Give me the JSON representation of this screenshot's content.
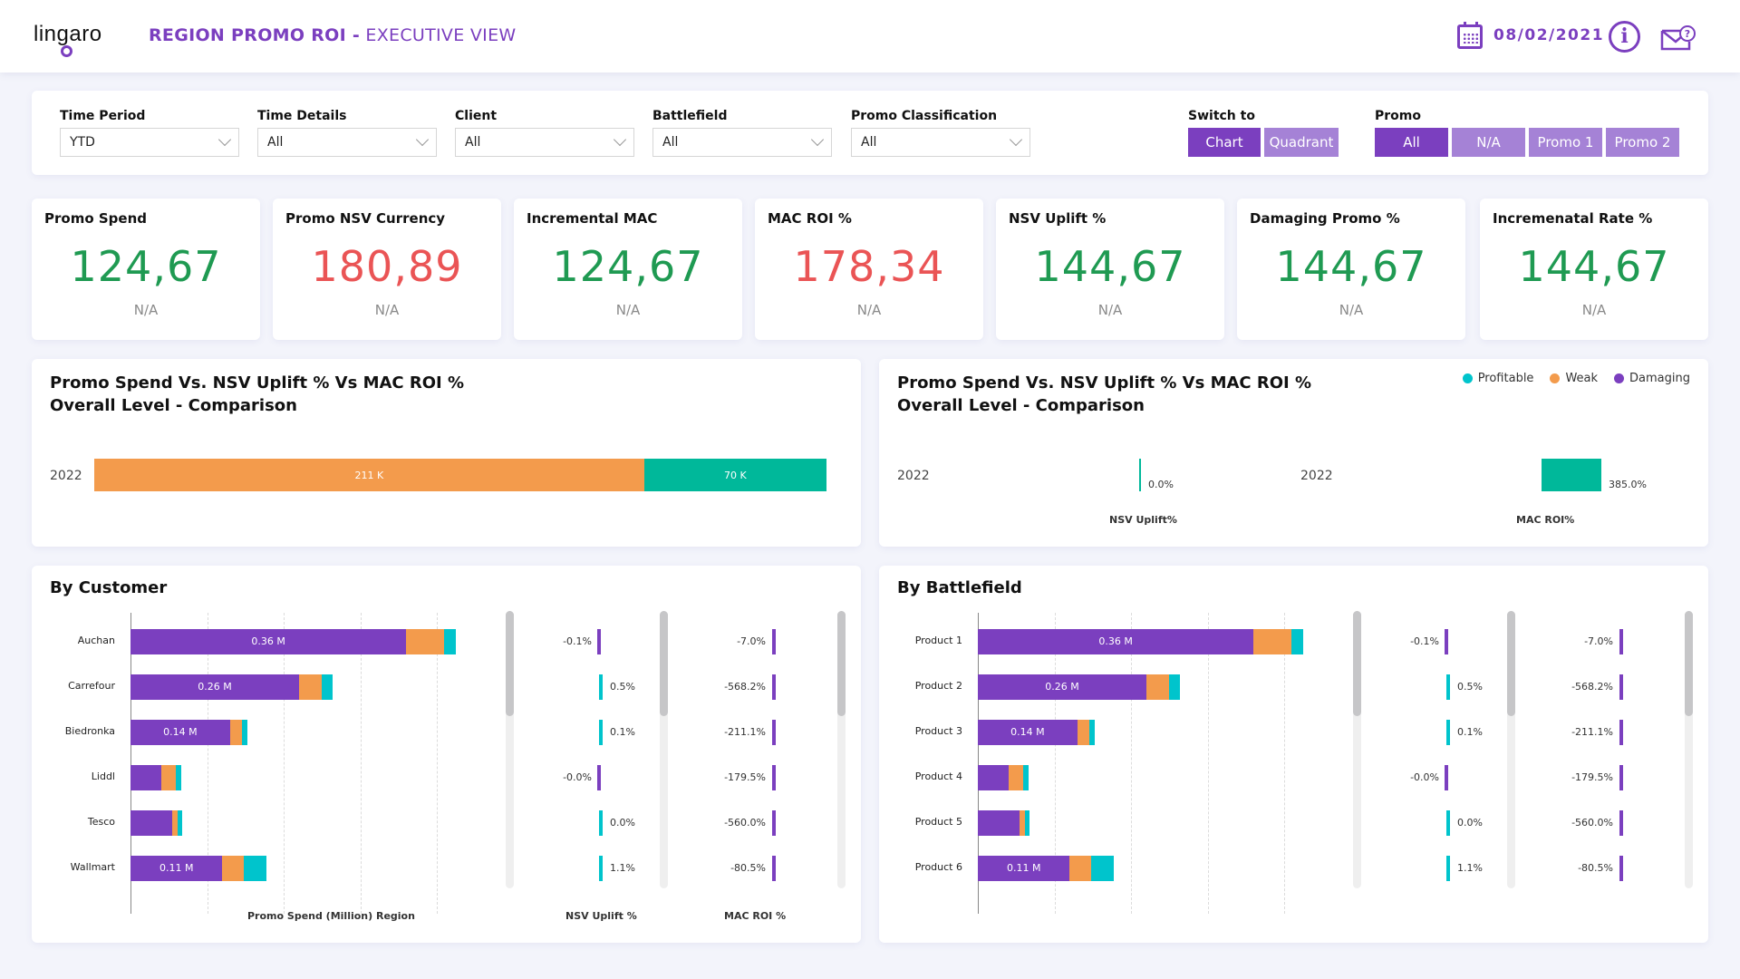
{
  "header": {
    "logo": "lingaro",
    "title_bold": "REGION PROMO ROI -",
    "title_light": " EXECUTIVE VIEW",
    "date": "08/02/2021",
    "icons": [
      "calendar-icon",
      "info-icon",
      "mail-help-icon"
    ]
  },
  "filters": {
    "dropdowns": [
      {
        "label": "Time Period",
        "value": "YTD"
      },
      {
        "label": "Time Details",
        "value": "All"
      },
      {
        "label": "Client",
        "value": "All"
      },
      {
        "label": "Battlefield",
        "value": "All"
      },
      {
        "label": "Promo Classification",
        "value": "All"
      }
    ],
    "switch_to": {
      "label": "Switch to",
      "options": [
        "Chart",
        "Quadrant"
      ],
      "selected": "Chart"
    },
    "promo": {
      "label": "Promo",
      "options": [
        "All",
        "N/A",
        "Promo 1",
        "Promo 2"
      ],
      "selected": "All"
    }
  },
  "colors": {
    "accent": "#7b3fbf",
    "accent_light": "#a582d6",
    "positive": "#1f9a52",
    "negative": "#ea5455",
    "profitable": "#00c4cc",
    "weak": "#f39b4c",
    "damaging": "#7b3fbf",
    "overall_teal": "#00b89a"
  },
  "kpis": [
    {
      "title": "Promo Spend",
      "value": "124,67",
      "sub": "N/A",
      "tone": "green"
    },
    {
      "title": "Promo NSV Currency",
      "value": "180,89",
      "sub": "N/A",
      "tone": "red"
    },
    {
      "title": "Incremental MAC",
      "value": "124,67",
      "sub": "N/A",
      "tone": "green"
    },
    {
      "title": "MAC ROI %",
      "value": "178,34",
      "sub": "N/A",
      "tone": "red"
    },
    {
      "title": "NSV Uplift %",
      "value": "144,67",
      "sub": "N/A",
      "tone": "green"
    },
    {
      "title": "Damaging Promo %",
      "value": "144,67",
      "sub": "N/A",
      "tone": "green"
    },
    {
      "title": "Incremenatal Rate %",
      "value": "144,67",
      "sub": "N/A",
      "tone": "green"
    }
  ],
  "legend": [
    {
      "label": "Profitable",
      "color": "#00c4cc"
    },
    {
      "label": "Weak",
      "color": "#f39b4c"
    },
    {
      "label": "Damaging",
      "color": "#7b3fbf"
    }
  ],
  "chart_data": [
    {
      "type": "bar",
      "orientation": "horizontal-stacked",
      "title": "Promo Spend Vs. NSV Uplift % Vs MAC ROI %",
      "subtitle": "Overall Level - Comparison",
      "categories": [
        "2022"
      ],
      "series": [
        {
          "name": "Weak",
          "values": [
            211
          ],
          "label": "211 K",
          "color": "#f39b4c"
        },
        {
          "name": "Profitable",
          "values": [
            70
          ],
          "label": "70 K",
          "color": "#00b89a"
        }
      ],
      "unit": "K"
    },
    {
      "type": "bar",
      "orientation": "horizontal",
      "title": "Promo Spend Vs. NSV Uplift % Vs MAC ROI %",
      "subtitle": "Overall Level - Comparison",
      "legend_position": "top-right",
      "panels": [
        {
          "xlabel": "NSV Uplift%",
          "categories": [
            "2022"
          ],
          "values": [
            0.0
          ],
          "labels": [
            "0.0%"
          ]
        },
        {
          "xlabel": "MAC ROI%",
          "categories": [
            "2022"
          ],
          "values": [
            385.0
          ],
          "labels": [
            "385.0%"
          ]
        }
      ]
    },
    {
      "type": "bar",
      "orientation": "horizontal-stacked",
      "title": "By Customer",
      "xlabel": "Promo Spend (Million) Region",
      "xlim": [
        0,
        0.45
      ],
      "grid": true,
      "categories": [
        "Auchan",
        "Carrefour",
        "Biedronka",
        "Liddl",
        "Tesco",
        "Wallmart"
      ],
      "series": [
        {
          "name": "Damaging",
          "values": [
            0.36,
            0.22,
            0.13,
            0.04,
            0.055,
            0.12
          ]
        },
        {
          "name": "Weak",
          "values": [
            0.05,
            0.03,
            0.016,
            0.019,
            0.006,
            0.028
          ]
        },
        {
          "name": "Profitable",
          "values": [
            0.015,
            0.014,
            0.007,
            0.007,
            0.007,
            0.03
          ]
        }
      ],
      "bar_labels": [
        "0.36 M",
        "0.26 M",
        "0.14 M",
        "",
        "",
        "0.11 M"
      ],
      "nsv_uplift": {
        "xlabel": "NSV Uplift %",
        "values": [
          -0.1,
          0.5,
          0.1,
          -0.0,
          0.0,
          1.1
        ],
        "labels": [
          "-0.1%",
          "0.5%",
          "0.1%",
          "-0.0%",
          "0.0%",
          "1.1%"
        ]
      },
      "mac_roi": {
        "xlabel": "MAC ROI %",
        "values": [
          -7.0,
          -568.2,
          -211.1,
          -179.5,
          -560.0,
          -80.5
        ],
        "labels": [
          "-7.0%",
          "-568.2%",
          "-211.1%",
          "-179.5%",
          "-560.0%",
          "-80.5%"
        ]
      }
    },
    {
      "type": "bar",
      "orientation": "horizontal-stacked",
      "title": "By Battlefield",
      "xlim": [
        0,
        0.45
      ],
      "grid": true,
      "categories": [
        "Product 1",
        "Product 2",
        "Product 3",
        "Product 4",
        "Product 5",
        "Product 6"
      ],
      "series": [
        {
          "name": "Damaging",
          "values": [
            0.36,
            0.22,
            0.13,
            0.04,
            0.055,
            0.12
          ]
        },
        {
          "name": "Weak",
          "values": [
            0.05,
            0.03,
            0.016,
            0.019,
            0.006,
            0.028
          ]
        },
        {
          "name": "Profitable",
          "values": [
            0.015,
            0.014,
            0.007,
            0.007,
            0.007,
            0.03
          ]
        }
      ],
      "bar_labels": [
        "0.36 M",
        "0.26 M",
        "0.14 M",
        "",
        "",
        "0.11 M"
      ],
      "nsv_uplift": {
        "values": [
          -0.1,
          0.5,
          0.1,
          -0.0,
          0.0,
          1.1
        ],
        "labels": [
          "-0.1%",
          "0.5%",
          "0.1%",
          "-0.0%",
          "0.0%",
          "1.1%"
        ]
      },
      "mac_roi": {
        "values": [
          -7.0,
          -568.2,
          -211.1,
          -179.5,
          -560.0,
          -80.5
        ],
        "labels": [
          "-7.0%",
          "-568.2%",
          "-211.1%",
          "-179.5%",
          "-560.0%",
          "-80.5%"
        ]
      }
    }
  ]
}
